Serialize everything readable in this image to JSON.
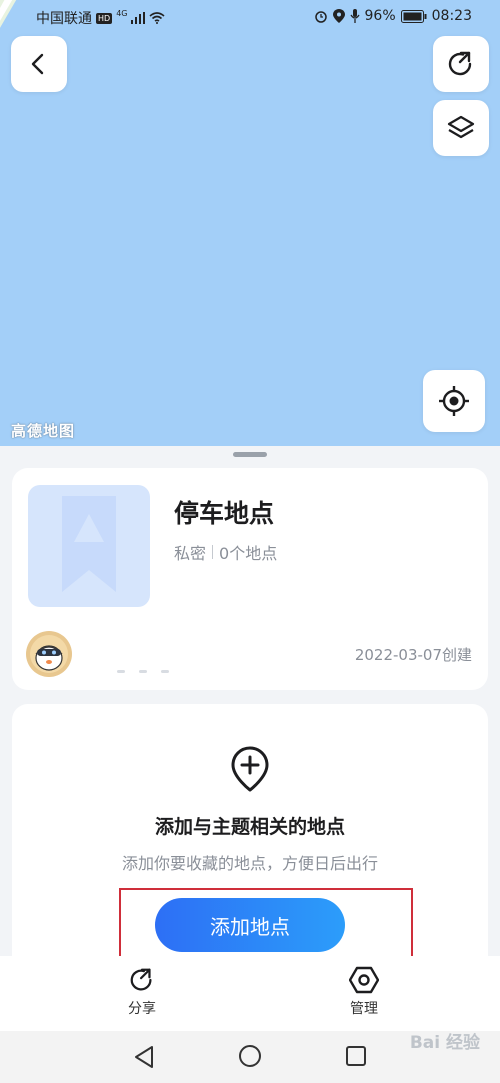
{
  "status_bar": {
    "carrier": "中国联通",
    "hd": "HD",
    "network": "4G",
    "battery": "96%",
    "time": "08:23"
  },
  "map": {
    "logo_text": "高德地图",
    "background_color": "#a3cff8",
    "buttons": {
      "back": "chevron-left-icon",
      "share": "share-icon",
      "layers": "layers-icon",
      "locate": "locate-icon"
    }
  },
  "favorite": {
    "title": "停车地点",
    "visibility": "私密",
    "count": "0个地点",
    "created": "2022-03-07创建"
  },
  "empty_state": {
    "title": "添加与主题相关的地点",
    "subtitle": "添加你要收藏的地点，方便日后出行",
    "button_label": "添加地点"
  },
  "tabbar": {
    "share_label": "分享",
    "manage_label": "管理"
  },
  "watermark": "Bai 经验",
  "colors": {
    "accent": "#2d6ff5",
    "highlight": "#cf2e3a"
  }
}
